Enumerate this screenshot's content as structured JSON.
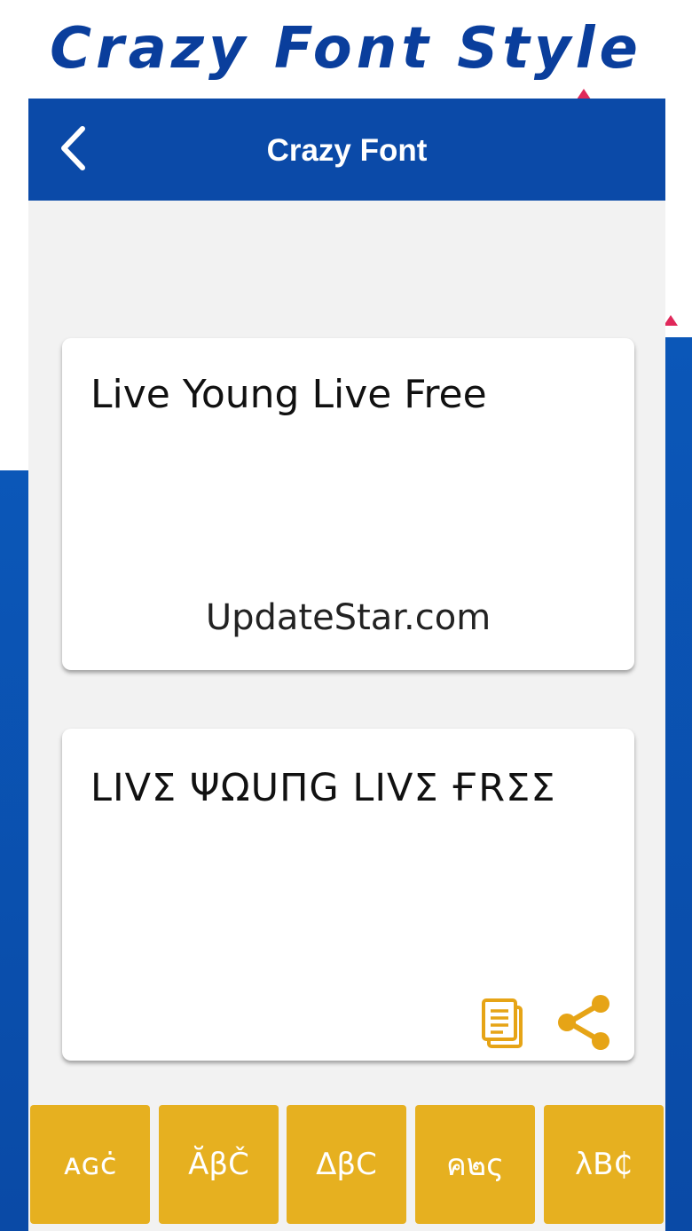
{
  "promo": {
    "title": "Crazy Font Style"
  },
  "app": {
    "title": "Crazy Font"
  },
  "input": {
    "text": "Live Young Live Free"
  },
  "output": {
    "text": "LIVΣ ΨΩUПG LIVΣ ҒRΣΣ"
  },
  "watermark": "UpdateStar.com",
  "colors": {
    "primary": "#0b4aa8",
    "accent": "#e6b020",
    "icon": "#e6a416"
  },
  "style_buttons": [
    {
      "label": "ᴀɢċ"
    },
    {
      "label": "ĂβČ"
    },
    {
      "label": "ΔβC"
    },
    {
      "label": "ค๒ς"
    },
    {
      "label": "λB₵"
    }
  ]
}
